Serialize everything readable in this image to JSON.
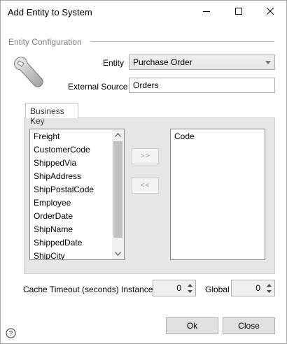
{
  "window": {
    "title": "Add Entity to System",
    "controls": [
      "minimize-icon",
      "maximize-icon",
      "close-icon"
    ]
  },
  "group": {
    "label": "Entity Configuration"
  },
  "form": {
    "entity_label": "Entity",
    "entity_value": "Purchase Order",
    "external_source_label": "External Source",
    "external_source_value": "Orders"
  },
  "business_key": {
    "tab_label": "Business Key",
    "available_fields": [
      "Freight",
      "CustomerCode",
      "ShippedVia",
      "ShipAddress",
      "ShipPostalCode",
      "Employee",
      "OrderDate",
      "ShipName",
      "ShippedDate",
      "ShipCity"
    ],
    "add_label": ">>",
    "remove_label": "<<",
    "selected_fields": [
      "Code"
    ]
  },
  "cache": {
    "timeout_label": "Cache Timeout (seconds)",
    "instance_label": "Instance",
    "instance_value": "0",
    "global_label": "Global",
    "global_value": "0"
  },
  "buttons": {
    "ok": "Ok",
    "close": "Close"
  },
  "icons": {
    "help": "help-icon",
    "entity": "wrench-icon"
  },
  "colors": {
    "panel": "#e6e6e6",
    "button": "#e1e1e1",
    "group_label": "#7f7f7f"
  }
}
